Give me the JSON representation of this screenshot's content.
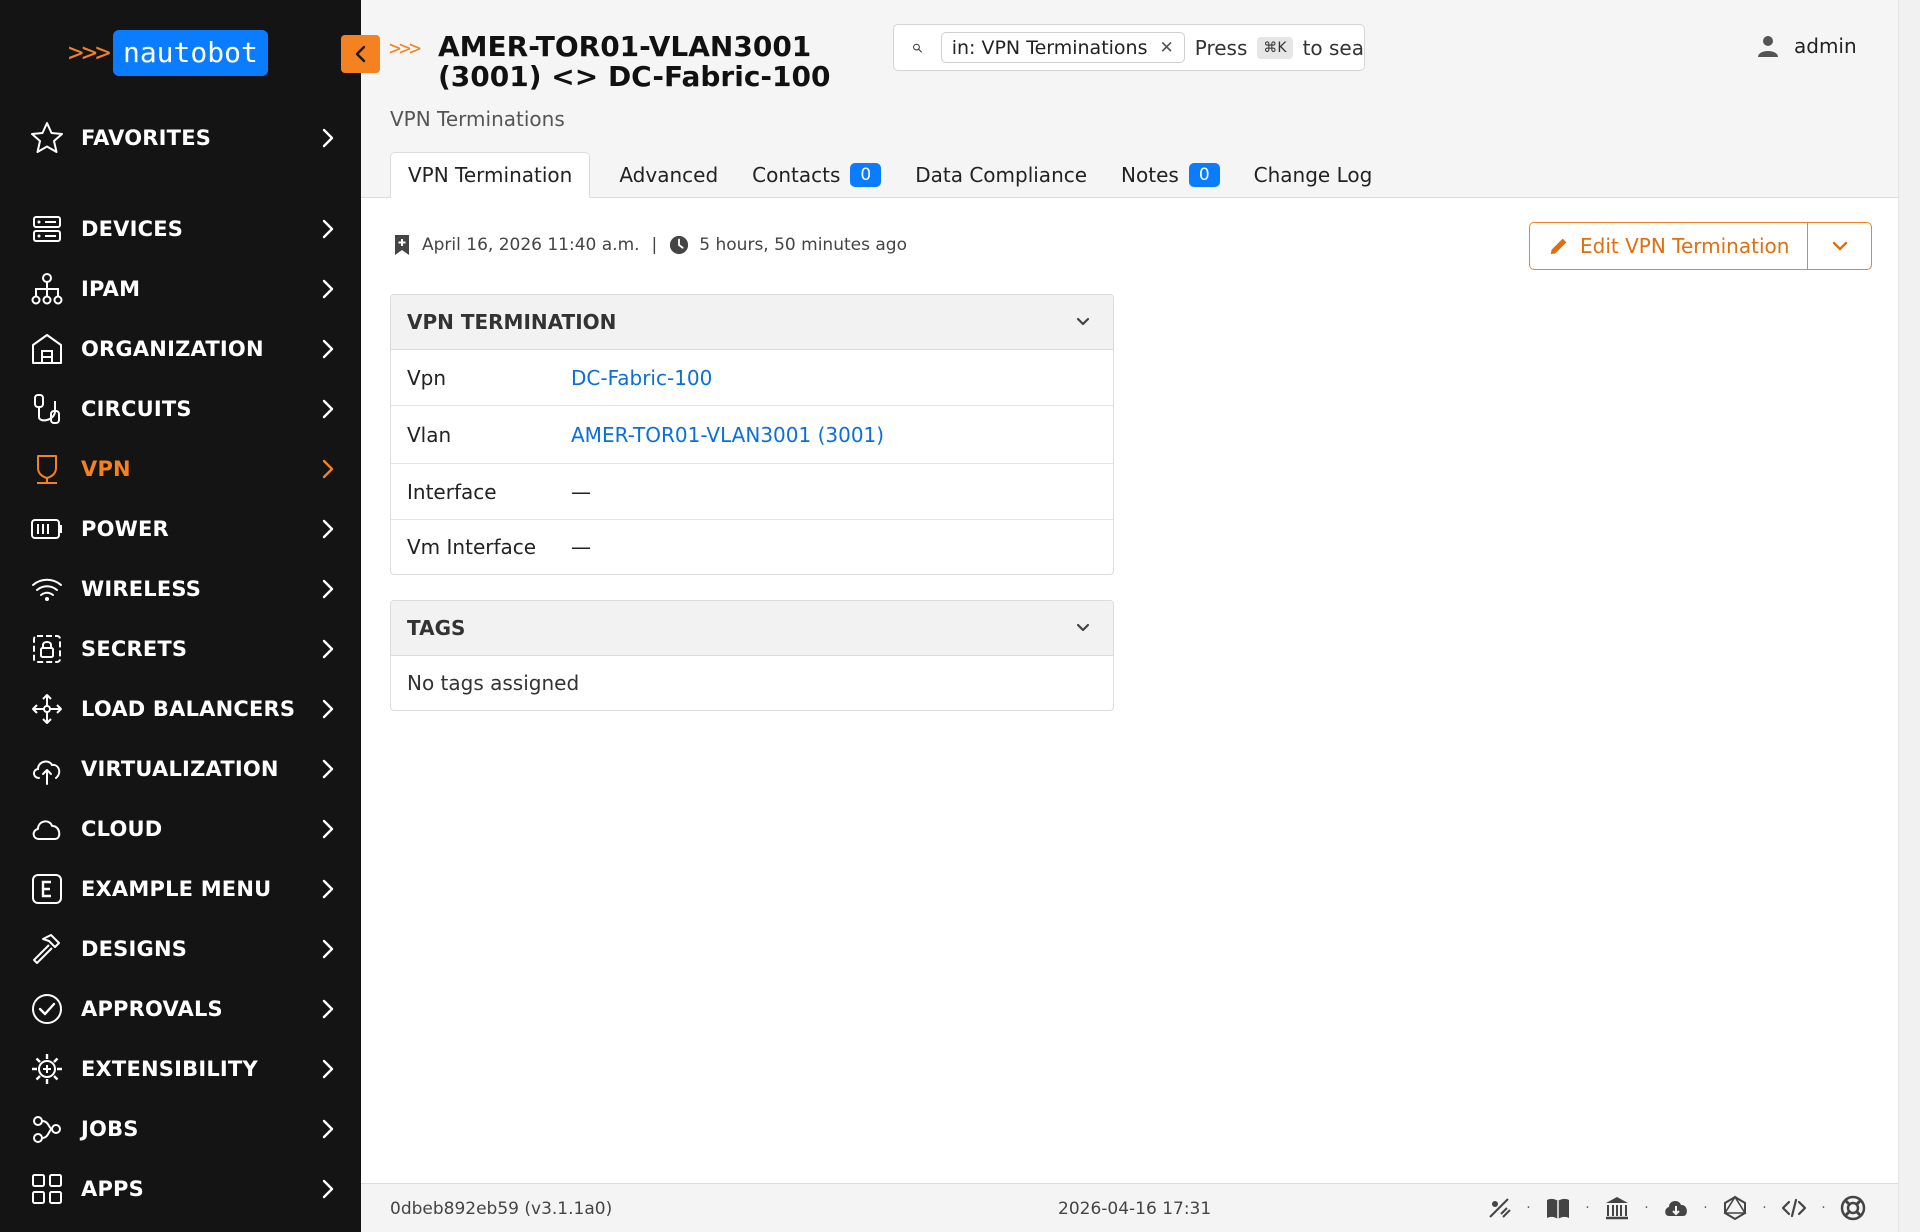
{
  "app": {
    "logo_text": "nautobot",
    "logo_arrows": ">>>"
  },
  "sidebar": {
    "items": [
      {
        "label": "FAVORITES",
        "icon": "star-icon"
      },
      {
        "label": "DEVICES",
        "icon": "server-icon"
      },
      {
        "label": "IPAM",
        "icon": "network-tree-icon"
      },
      {
        "label": "ORGANIZATION",
        "icon": "building-icon"
      },
      {
        "label": "CIRCUITS",
        "icon": "cable-icon"
      },
      {
        "label": "VPN",
        "icon": "shield-network-icon",
        "active": true
      },
      {
        "label": "POWER",
        "icon": "battery-icon"
      },
      {
        "label": "WIRELESS",
        "icon": "wifi-icon"
      },
      {
        "label": "SECRETS",
        "icon": "lock-icon"
      },
      {
        "label": "LOAD BALANCERS",
        "icon": "move-arrows-icon"
      },
      {
        "label": "VIRTUALIZATION",
        "icon": "cloud-upload-icon"
      },
      {
        "label": "CLOUD",
        "icon": "cloud-icon"
      },
      {
        "label": "EXAMPLE MENU",
        "icon": "letter-e-icon"
      },
      {
        "label": "DESIGNS",
        "icon": "hammer-icon"
      },
      {
        "label": "APPROVALS",
        "icon": "check-circle-icon"
      },
      {
        "label": "EXTENSIBILITY",
        "icon": "gear-plus-icon"
      },
      {
        "label": "JOBS",
        "icon": "workflow-icon"
      },
      {
        "label": "APPS",
        "icon": "grid-icon"
      }
    ]
  },
  "header": {
    "arrows": ">>>",
    "title": "AMER-TOR01-VLAN3001 (3001) <> DC-Fabric-100",
    "breadcrumb": "VPN Terminations",
    "search": {
      "chip": "in: VPN Terminations",
      "hint_pre": "Press",
      "kbd": "⌘K",
      "hint_post": "to sea"
    },
    "user": "admin"
  },
  "tabs": [
    {
      "label": "VPN Termination",
      "active": true
    },
    {
      "label": "Advanced"
    },
    {
      "label": "Contacts",
      "badge": "0"
    },
    {
      "label": "Data Compliance"
    },
    {
      "label": "Notes",
      "badge": "0"
    },
    {
      "label": "Change Log"
    }
  ],
  "meta": {
    "created": "April 16, 2026 11:40 a.m.",
    "separator": "|",
    "updated": "5 hours, 50 minutes ago"
  },
  "actions": {
    "edit_label": "Edit VPN Termination"
  },
  "panel_termination": {
    "title": "VPN TERMINATION",
    "rows": [
      {
        "key": "Vpn",
        "value": "DC-Fabric-100",
        "link": true
      },
      {
        "key": "Vlan",
        "value": "AMER-TOR01-VLAN3001 (3001)",
        "link": true
      },
      {
        "key": "Interface",
        "value": "—"
      },
      {
        "key": "Vm Interface",
        "value": "—"
      }
    ]
  },
  "panel_tags": {
    "title": "TAGS",
    "empty": "No tags assigned"
  },
  "footer": {
    "version": "0dbeb892eb59 (v3.1.1a0)",
    "timestamp": "2026-04-16 17:31",
    "icons": [
      "theme-toggle-icon",
      "docs-book-icon",
      "museum-icon",
      "cloud-download-icon",
      "graphql-icon",
      "code-icon",
      "help-lifebuoy-icon"
    ]
  },
  "colors": {
    "accent": "#f58220",
    "brand_blue": "#0a7cff",
    "link": "#0a6fdb",
    "sidebar_bg": "#141414"
  }
}
